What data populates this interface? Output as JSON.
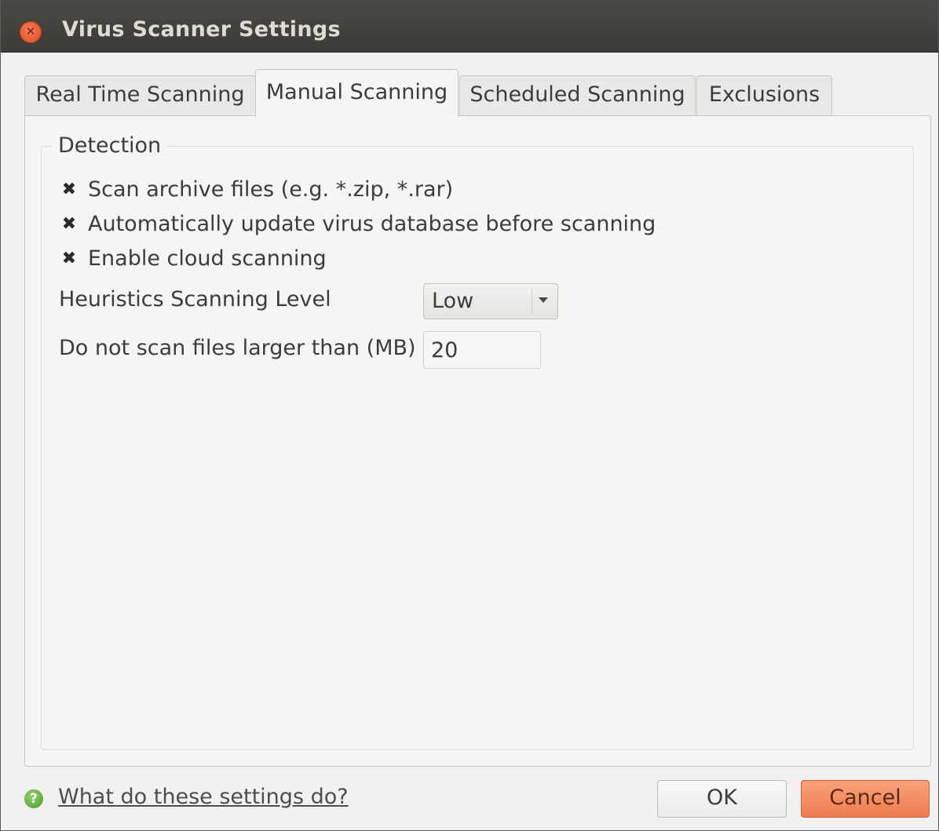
{
  "window": {
    "title": "Virus Scanner Settings",
    "close_icon": "close-icon"
  },
  "tabs": [
    {
      "label": "Real Time Scanning",
      "active": false
    },
    {
      "label": "Manual Scanning",
      "active": true
    },
    {
      "label": "Scheduled Scanning",
      "active": false
    },
    {
      "label": "Exclusions",
      "active": false
    }
  ],
  "detection": {
    "title": "Detection",
    "options": [
      {
        "label": "Scan archive files (e.g. *.zip, *.rar)",
        "checked": true,
        "mark": "✖"
      },
      {
        "label": "Automatically update virus database before scanning",
        "checked": true,
        "mark": "✖"
      },
      {
        "label": "Enable cloud scanning",
        "checked": true,
        "mark": "✖"
      }
    ],
    "heuristics": {
      "label": "Heuristics Scanning Level",
      "value": "Low"
    },
    "max_size": {
      "label": "Do not scan files larger than (MB)",
      "value": "20"
    }
  },
  "footer": {
    "help_icon": "?",
    "help_link": "What do these settings do?",
    "ok_label": "OK",
    "cancel_label": "Cancel"
  },
  "colors": {
    "titlebar": "#3c3b37",
    "background": "#f2f1f0",
    "accent": "#ee7c4f",
    "help_icon": "#4a9a2a"
  }
}
